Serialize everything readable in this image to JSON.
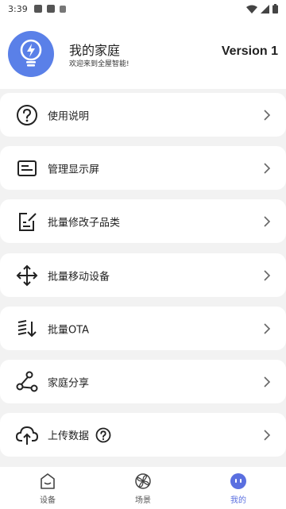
{
  "status_bar": {
    "time": "3:39"
  },
  "header": {
    "title": "我的家庭",
    "subtitle": "欢迎来到全屋智能!",
    "version": "Version 1",
    "avatar_icon": "lightbulb-icon"
  },
  "menu": [
    {
      "label": "使用说明",
      "icon": "question-circle-icon"
    },
    {
      "label": "管理显示屏",
      "icon": "display-icon"
    },
    {
      "label": "批量修改子品类",
      "icon": "edit-document-icon"
    },
    {
      "label": "批量移动设备",
      "icon": "move-arrows-icon"
    },
    {
      "label": "批量OTA",
      "icon": "ota-update-icon"
    },
    {
      "label": "家庭分享",
      "icon": "share-icon"
    },
    {
      "label": "上传数据",
      "icon": "cloud-upload-icon"
    }
  ],
  "tabs": [
    {
      "label": "设备",
      "icon": "device-icon",
      "active": false
    },
    {
      "label": "场景",
      "icon": "scene-icon",
      "active": false
    },
    {
      "label": "我的",
      "icon": "profile-icon",
      "active": true
    }
  ],
  "colors": {
    "accent": "#5a6fe0",
    "avatar_bg": "#5a80e8",
    "background": "#f2f2f2"
  }
}
